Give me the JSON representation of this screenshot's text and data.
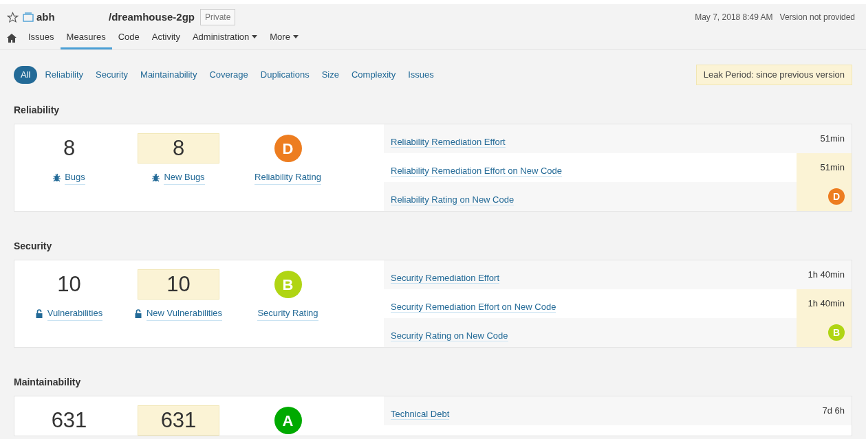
{
  "project": {
    "org": "abh",
    "name": "/dreamhouse-2gp",
    "visibility": "Private",
    "date": "May 7, 2018 8:49 AM",
    "version": "Version not provided"
  },
  "nav": [
    {
      "label": "Issues",
      "selected": false,
      "has_menu": false
    },
    {
      "label": "Measures",
      "selected": true,
      "has_menu": false
    },
    {
      "label": "Code",
      "selected": false,
      "has_menu": false
    },
    {
      "label": "Activity",
      "selected": false,
      "has_menu": false
    },
    {
      "label": "Administration",
      "selected": false,
      "has_menu": true
    },
    {
      "label": "More",
      "selected": false,
      "has_menu": true
    }
  ],
  "filters": [
    {
      "label": "All",
      "selected": true
    },
    {
      "label": "Reliability",
      "selected": false
    },
    {
      "label": "Security",
      "selected": false
    },
    {
      "label": "Maintainability",
      "selected": false
    },
    {
      "label": "Coverage",
      "selected": false
    },
    {
      "label": "Duplications",
      "selected": false
    },
    {
      "label": "Size",
      "selected": false
    },
    {
      "label": "Complexity",
      "selected": false
    },
    {
      "label": "Issues",
      "selected": false
    }
  ],
  "leak_period": "Leak Period: since previous version",
  "sections": [
    {
      "title": "Reliability",
      "metrics": [
        {
          "kind": "count",
          "value": "8",
          "label": "Bugs",
          "leak": false
        },
        {
          "kind": "count",
          "value": "8",
          "label": "New Bugs",
          "leak": true
        },
        {
          "kind": "rating",
          "value": "D",
          "label": "Reliability Rating",
          "color": "#ed7d20"
        }
      ],
      "rows": [
        {
          "label": "Reliability Remediation Effort",
          "kind": "text",
          "value": "51min",
          "leak": false
        },
        {
          "label": "Reliability Remediation Effort on New Code",
          "kind": "text",
          "value": "51min",
          "leak": true
        },
        {
          "label": "Reliability Rating on New Code",
          "kind": "rating",
          "value": "D",
          "color": "#ed7d20",
          "leak": true
        }
      ]
    },
    {
      "title": "Security",
      "metrics": [
        {
          "kind": "count",
          "value": "10",
          "label": "Vulnerabilities",
          "leak": false
        },
        {
          "kind": "count",
          "value": "10",
          "label": "New Vulnerabilities",
          "leak": true
        },
        {
          "kind": "rating",
          "value": "B",
          "label": "Security Rating",
          "color": "#b0d513"
        }
      ],
      "rows": [
        {
          "label": "Security Remediation Effort",
          "kind": "text",
          "value": "1h 40min",
          "leak": false
        },
        {
          "label": "Security Remediation Effort on New Code",
          "kind": "text",
          "value": "1h 40min",
          "leak": true
        },
        {
          "label": "Security Rating on New Code",
          "kind": "rating",
          "value": "B",
          "color": "#b0d513",
          "leak": true
        }
      ]
    },
    {
      "title": "Maintainability",
      "metrics": [
        {
          "kind": "count",
          "value": "631",
          "leak": false
        },
        {
          "kind": "count",
          "value": "631",
          "leak": true
        },
        {
          "kind": "rating",
          "value": "A",
          "color": "#00aa00"
        }
      ],
      "rows": [
        {
          "label": "Technical Debt",
          "kind": "text",
          "value": "7d 6h",
          "leak": false
        }
      ]
    }
  ]
}
